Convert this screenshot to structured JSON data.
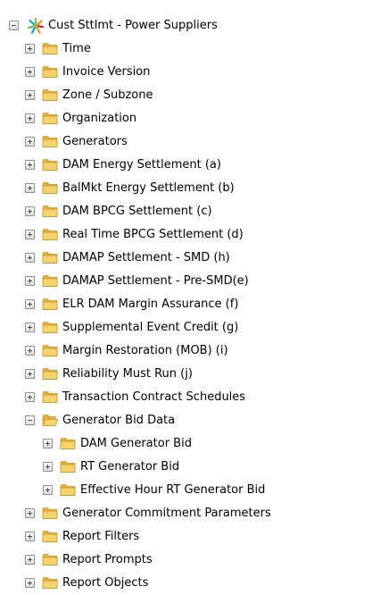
{
  "tree": {
    "root_label": "Cust Sttlmt - Power Suppliers",
    "items": [
      {
        "label": "Time",
        "level": 1,
        "expanded": false
      },
      {
        "label": "Invoice Version",
        "level": 1,
        "expanded": false
      },
      {
        "label": "Zone / Subzone",
        "level": 1,
        "expanded": false
      },
      {
        "label": "Organization",
        "level": 1,
        "expanded": false
      },
      {
        "label": "Generators",
        "level": 1,
        "expanded": false
      },
      {
        "label": "DAM Energy Settlement (a)",
        "level": 1,
        "expanded": false
      },
      {
        "label": "BalMkt Energy Settlement (b)",
        "level": 1,
        "expanded": false
      },
      {
        "label": "DAM BPCG Settlement (c)",
        "level": 1,
        "expanded": false
      },
      {
        "label": "Real Time BPCG Settlement (d)",
        "level": 1,
        "expanded": false
      },
      {
        "label": "DAMAP Settlement - SMD (h)",
        "level": 1,
        "expanded": false
      },
      {
        "label": "DAMAP Settlement - Pre-SMD(e)",
        "level": 1,
        "expanded": false
      },
      {
        "label": "ELR DAM Margin Assurance (f)",
        "level": 1,
        "expanded": false
      },
      {
        "label": "Supplemental Event Credit (g)",
        "level": 1,
        "expanded": false
      },
      {
        "label": "Margin Restoration (MOB) (i)",
        "level": 1,
        "expanded": false
      },
      {
        "label": "Reliability Must Run (j)",
        "level": 1,
        "expanded": false
      },
      {
        "label": "Transaction Contract Schedules",
        "level": 1,
        "expanded": false
      },
      {
        "label": "Generator Bid Data",
        "level": 1,
        "expanded": true
      },
      {
        "label": "DAM Generator Bid",
        "level": 2,
        "expanded": false
      },
      {
        "label": "RT Generator Bid",
        "level": 2,
        "expanded": false
      },
      {
        "label": "Effective Hour RT Generator Bid",
        "level": 2,
        "expanded": false
      },
      {
        "label": "Generator Commitment Parameters",
        "level": 1,
        "expanded": false
      },
      {
        "label": "Report Filters",
        "level": 1,
        "expanded": false
      },
      {
        "label": "Report Prompts",
        "level": 1,
        "expanded": false
      },
      {
        "label": "Report Objects",
        "level": 1,
        "expanded": false
      }
    ]
  },
  "colors": {
    "folder_fill": "#f6d36b",
    "folder_dark": "#e3b341",
    "folder_stroke": "#c9962a"
  },
  "icons": {
    "root": "project-star-icon",
    "folder": "folder-icon",
    "folder_open": "folder-open-icon",
    "expand": "expand-plus-icon",
    "collapse": "collapse-minus-icon"
  }
}
